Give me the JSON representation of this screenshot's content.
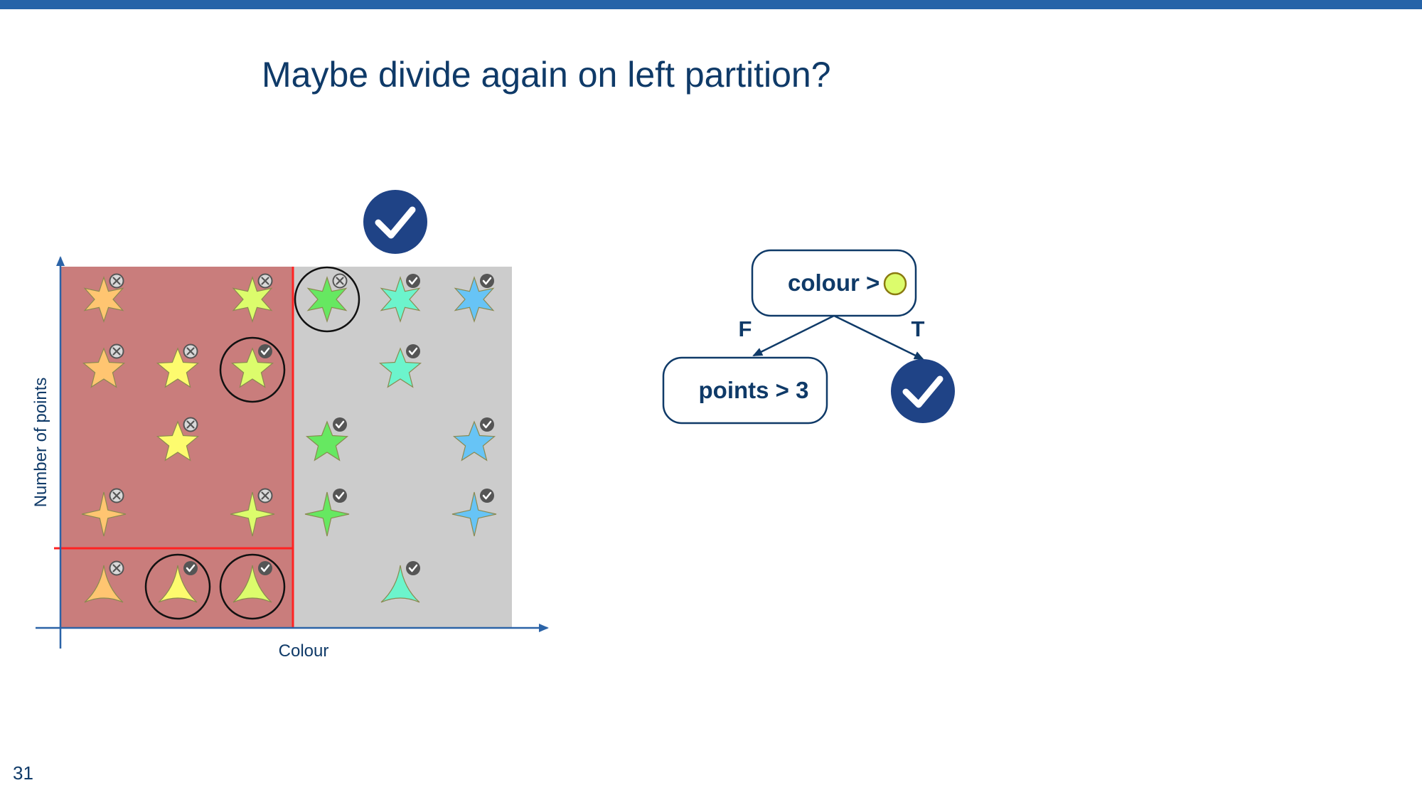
{
  "slide": {
    "title": "Maybe divide again on left partition?",
    "page_number": "31"
  },
  "scatter": {
    "xlabel": "Colour",
    "ylabel": "Number of points",
    "colors": {
      "axis": "#2b63a7",
      "left_region": "#c97d7c",
      "right_region": "#cccccc",
      "split_line": "#ff2222",
      "badge": "#555555",
      "check_circle": "#1f4386"
    },
    "points": [
      {
        "col": 0,
        "row": 0,
        "shape": "star6",
        "fill": "#ffc571",
        "mark": "cross",
        "circled": false
      },
      {
        "col": 2,
        "row": 0,
        "shape": "star6",
        "fill": "#dcfc6c",
        "mark": "cross",
        "circled": false
      },
      {
        "col": 3,
        "row": 0,
        "shape": "star6",
        "fill": "#66e861",
        "mark": "cross",
        "circled": true
      },
      {
        "col": 4,
        "row": 0,
        "shape": "star6",
        "fill": "#6cf4cc",
        "mark": "check",
        "circled": false
      },
      {
        "col": 5,
        "row": 0,
        "shape": "star6",
        "fill": "#67c4f6",
        "mark": "check",
        "circled": false
      },
      {
        "col": 0,
        "row": 1,
        "shape": "star5",
        "fill": "#ffc571",
        "mark": "cross",
        "circled": false
      },
      {
        "col": 1,
        "row": 1,
        "shape": "star5",
        "fill": "#fdfb6e",
        "mark": "cross",
        "circled": false
      },
      {
        "col": 2,
        "row": 1,
        "shape": "star5",
        "fill": "#dcfc6c",
        "mark": "check",
        "circled": true
      },
      {
        "col": 4,
        "row": 1,
        "shape": "star5",
        "fill": "#6cf4cc",
        "mark": "check",
        "circled": false
      },
      {
        "col": 1,
        "row": 2,
        "shape": "star5",
        "fill": "#fdfb6e",
        "mark": "cross",
        "circled": false
      },
      {
        "col": 3,
        "row": 2,
        "shape": "star5",
        "fill": "#66e861",
        "mark": "check",
        "circled": false
      },
      {
        "col": 5,
        "row": 2,
        "shape": "star5",
        "fill": "#67c4f6",
        "mark": "check",
        "circled": false
      },
      {
        "col": 0,
        "row": 3,
        "shape": "star4",
        "fill": "#ffc571",
        "mark": "cross",
        "circled": false
      },
      {
        "col": 2,
        "row": 3,
        "shape": "star4",
        "fill": "#dcfc6c",
        "mark": "cross",
        "circled": false
      },
      {
        "col": 3,
        "row": 3,
        "shape": "star4",
        "fill": "#66e861",
        "mark": "check",
        "circled": false
      },
      {
        "col": 5,
        "row": 3,
        "shape": "star4",
        "fill": "#67c4f6",
        "mark": "check",
        "circled": false
      },
      {
        "col": 0,
        "row": 4,
        "shape": "tri",
        "fill": "#ffc571",
        "mark": "cross",
        "circled": false
      },
      {
        "col": 1,
        "row": 4,
        "shape": "tri",
        "fill": "#fdfb6e",
        "mark": "check",
        "circled": true
      },
      {
        "col": 2,
        "row": 4,
        "shape": "tri",
        "fill": "#dcfc6c",
        "mark": "check",
        "circled": true
      },
      {
        "col": 4,
        "row": 4,
        "shape": "tri",
        "fill": "#6cf4cc",
        "mark": "check",
        "circled": false
      }
    ]
  },
  "tree": {
    "root_label": "colour >",
    "root_colour_swatch": "#dcfc6c",
    "false_label": "F",
    "true_label": "T",
    "left_child_label": "points > 3",
    "colors": {
      "node_border": "#0f3a68",
      "text": "#0f3a68",
      "check_circle": "#1f4386"
    }
  }
}
